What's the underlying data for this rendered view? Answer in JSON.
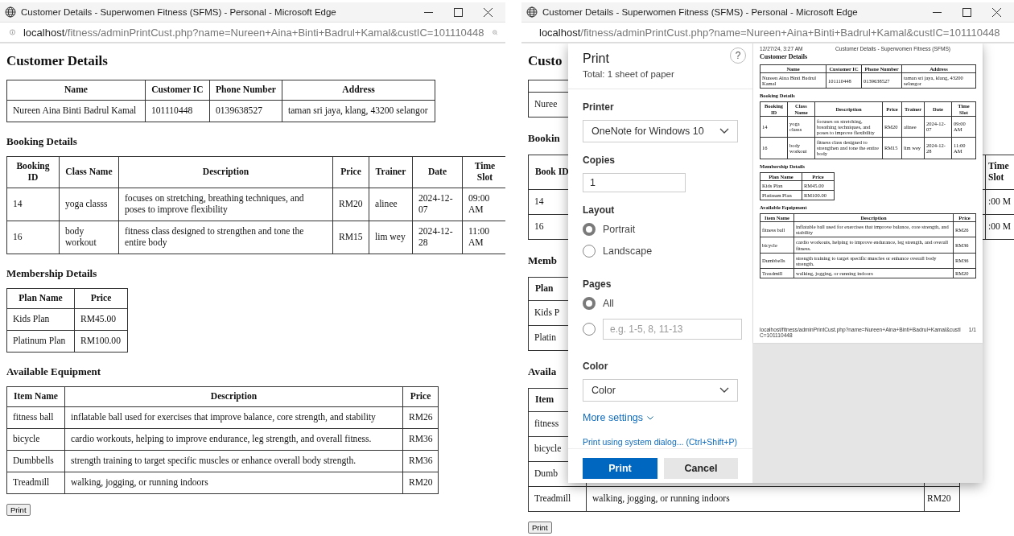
{
  "left_window": {
    "title": "Customer Details - Superwomen Fitness (SFMS) - Personal - Microsoft Edge",
    "url": "**localhost**/fitness/adminPrintCust.php?name=Nureen+Aina+Binti+Badrul+Kamal&custIC=101110448",
    "page": {
      "title": "Customer Details",
      "tables": [
        {
          "columns": [
            "Name",
            "Customer IC",
            "Phone Number",
            "Address"
          ],
          "rows": [
            [
              "Nureen Aina Binti Badrul Kamal",
              "101110448",
              "0139638527",
              "taman sri jaya, klang, 43200 selangor"
            ]
          ]
        },
        {
          "heading": "Booking Details",
          "columns": [
            "Booking ID",
            "Class Name",
            "Description",
            "Price",
            "Trainer",
            "Date",
            "Time Slot"
          ],
          "rows": [
            [
              "14",
              "yoga classs",
              "focuses on stretching, breathing techniques, and poses to improve flexibility",
              "RM20",
              "alinee",
              "2024-12-07",
              "09:00 AM"
            ],
            [
              "16",
              "body workout",
              "fitness class designed to strengthen and tone the entire body",
              "RM15",
              "lim wey",
              "2024-12-28",
              "11:00 AM"
            ]
          ]
        },
        {
          "heading": "Membership Details",
          "columns": [
            "Plan Name",
            "Price"
          ],
          "rows": [
            [
              "Kids Plan",
              "RM45.00"
            ],
            [
              "Platinum Plan",
              "RM100.00"
            ]
          ]
        },
        {
          "heading": "Available Equipment",
          "columns": [
            "Item Name",
            "Description",
            "Price"
          ],
          "rows": [
            [
              "fitness ball",
              "inflatable ball used for exercises that improve balance, core strength, and stability",
              "RM26"
            ],
            [
              "bicycle",
              "cardio workouts, helping to improve endurance, leg strength, and overall fitness.",
              "RM36"
            ],
            [
              "Dumbbells",
              "strength training to target specific muscles or enhance overall body strength.",
              "RM36"
            ],
            [
              "Treadmill",
              "walking, jogging, or running indoors",
              "RM20"
            ]
          ]
        }
      ],
      "print_button": "Print"
    }
  },
  "right_window": {
    "title": "Customer Details - Superwomen Fitness (SFMS) - Personal - Microsoft Edge",
    "url": "**localhost**/fitness/adminPrintCust.php?name=Nureen+Aina+Binti+Badrul+Kamal&custIC=101110448",
    "page": {
      "title": "Custo",
      "tables": [
        {
          "rows": [
            [
              "Nuree"
            ]
          ]
        },
        {
          "heading": "Bookin",
          "columns": [
            "Book ID",
            null,
            null,
            null,
            null,
            null,
            "Time Slot"
          ],
          "rows": [
            [
              "14",
              null,
              null,
              null,
              null,
              null,
              ":00 M"
            ],
            [
              "16",
              null,
              null,
              null,
              null,
              null,
              ":00 M"
            ]
          ]
        },
        {
          "heading": "Memb",
          "columns": [
            "Plan"
          ],
          "rows": [
            [
              "Kids P"
            ],
            [
              "Platin"
            ]
          ]
        },
        {
          "heading": "Availa",
          "columns": [
            "Item"
          ],
          "rows": [
            [
              "fitness"
            ],
            [
              "bicycle"
            ],
            [
              "Dumb"
            ],
            [
              "Treadmill",
              "walking, jogging, or running indoors",
              "RM20"
            ]
          ]
        }
      ],
      "print_button": "Print"
    },
    "print_dialog": {
      "title": "Print",
      "subtitle": "Total: 1 sheet of paper",
      "help": "?",
      "printer_label": "Printer",
      "printer": "OneNote for Windows 10",
      "copies_label": "Copies",
      "copies": "1",
      "layout_label": "Layout",
      "layout_options": [
        {
          "label": "Portrait",
          "selected": true
        },
        {
          "label": "Landscape",
          "selected": false
        }
      ],
      "pages_label": "Pages",
      "pages_options": [
        {
          "kind": "all",
          "label": "All",
          "selected": true
        },
        {
          "kind": "range",
          "placeholder": "e.g. 1-5, 8, 11-13",
          "selected": false
        }
      ],
      "color_label": "Color",
      "color_mode": "Color",
      "more_settings": "More settings",
      "system_dialog": "Print using system dialog... (Ctrl+Shift+P)",
      "print_button": "Print",
      "cancel_button": "Cancel",
      "preview": {
        "date": "12/27/24, 3:27 AM",
        "doc_title": "Customer Details - Superwomen Fitness (SFMS)",
        "page": {
          "title": "Customer Details",
          "tables": [
            {
              "columns": [
                "Name",
                "Customer IC",
                "Phone Number",
                "Address"
              ],
              "rows": [
                [
                  "Nureen Aina Binti Badrul Kamal",
                  "101110448",
                  "0139638527",
                  "taman sri jaya, klang, 43200 selangor"
                ]
              ]
            },
            {
              "heading": "Booking Details",
              "columns": [
                "Booking ID",
                "Class Name",
                "Description",
                "Price",
                "Trainer",
                "Date",
                "Time Slot"
              ],
              "rows": [
                [
                  "14",
                  "yoga classs",
                  "focuses on stretching, breathing techniques, and poses to improve flexibility",
                  "RM20",
                  "alinee",
                  "2024-12-07",
                  "09:00 AM"
                ],
                [
                  "16",
                  "body workout",
                  "fitness class designed to strengthen and tone the entire body",
                  "RM15",
                  "lim wey",
                  "2024-12-28",
                  "11:00 AM"
                ]
              ]
            },
            {
              "heading": "Membership Details",
              "columns": [
                "Plan Name",
                "Price"
              ],
              "rows": [
                [
                  "Kids Plan",
                  "RM45.00"
                ],
                [
                  "Platinum Plan",
                  "RM100.00"
                ]
              ]
            },
            {
              "heading": "Available Equipment",
              "columns": [
                "Item Name",
                "Description",
                "Price"
              ],
              "rows": [
                [
                  "fitness ball",
                  "inflatable ball used for exercises that improve balance, core strength, and stability",
                  "RM26"
                ],
                [
                  "bicycle",
                  "cardio workouts, helping to improve endurance, leg strength, and overall fitness.",
                  "RM36"
                ],
                [
                  "Dumbbells",
                  "strength training to target specific muscles or enhance overall body strength.",
                  "RM36"
                ],
                [
                  "Treadmill",
                  "walking, jogging, or running indoors",
                  "RM20"
                ]
              ]
            }
          ]
        },
        "footer_url": "localhost/fitness/adminPrintCust.php?name=Nureen+Aina+Binti+Badrul+Kamal&custIC=101110448",
        "page_number": "1/1"
      }
    }
  }
}
